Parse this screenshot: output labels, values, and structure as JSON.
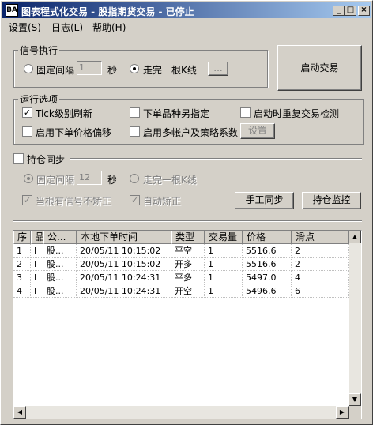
{
  "window": {
    "app_icon_text": "BA",
    "title": "图表程式化交易 - 股指期货交易 - 已停止",
    "min": "_",
    "max": "□",
    "close": "×"
  },
  "menu": [
    "设置(S)",
    "日志(L)",
    "帮助(H)"
  ],
  "signal": {
    "group_label": "信号执行",
    "fixed_interval_label": "固定间隔",
    "interval_value": "1",
    "seconds_label": "秒",
    "bar_close_label": "走完一根K线",
    "dots_button": "...",
    "selected": "bar_close"
  },
  "start_button": "启动交易",
  "run": {
    "group_label": "运行选项",
    "tick_refresh": {
      "label": "Tick级别刷新",
      "checked": true
    },
    "separate_specify": {
      "label": "下单品种另指定",
      "checked": false
    },
    "restart_check": {
      "label": "启动时重复交易检测",
      "checked": false
    },
    "price_offset": {
      "label": "启用下单价格偏移",
      "checked": false
    },
    "multi_account": {
      "label": "启用多帐户及策略系数",
      "checked": false
    },
    "settings_button": "设置"
  },
  "sync": {
    "label": "持仓同步",
    "checked": false,
    "fixed_interval_label": "固定间隔",
    "interval_value": "12",
    "seconds_label": "秒",
    "bar_close_label": "走完一根K线",
    "no_correct_label": "当根有信号不矫正",
    "auto_correct_label": "自动矫正",
    "manual_sync_button": "手工同步",
    "monitor_button": "持仓监控"
  },
  "table": {
    "columns": [
      "序",
      "品",
      "公...",
      "本地下单时间",
      "类型",
      "交易量",
      "价格",
      "滑点"
    ],
    "rows": [
      [
        "1",
        "I",
        "股...",
        "20/05/11 10:15:02",
        "平空",
        "1",
        "5516.6",
        "2"
      ],
      [
        "2",
        "I",
        "股...",
        "20/05/11 10:15:02",
        "开多",
        "1",
        "5516.6",
        "2"
      ],
      [
        "3",
        "I",
        "股...",
        "20/05/11 10:24:31",
        "平多",
        "1",
        "5497.0",
        "4"
      ],
      [
        "4",
        "I",
        "股...",
        "20/05/11 10:24:31",
        "开空",
        "1",
        "5496.6",
        "6"
      ]
    ]
  }
}
